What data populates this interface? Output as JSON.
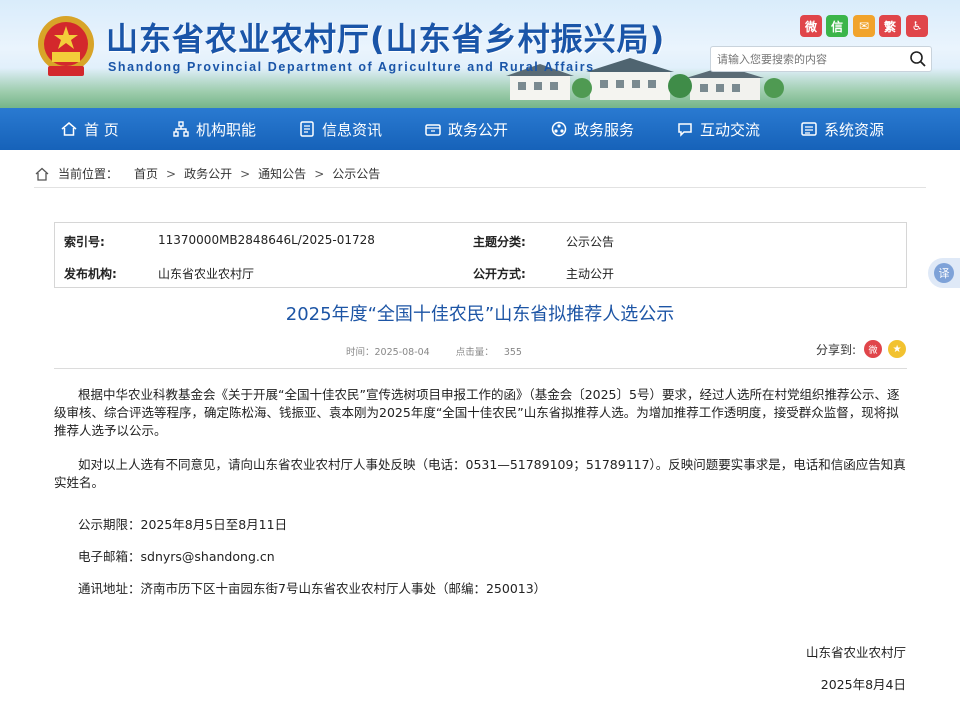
{
  "header": {
    "title": "山东省农业农村厅(山东省乡村振兴局)",
    "subtitle": "Shandong Provincial Department of Agriculture and Rural Affairs",
    "social": [
      {
        "name": "weibo-icon",
        "color": "#e0454a",
        "glyph": "微"
      },
      {
        "name": "wechat-icon",
        "color": "#3bb54a",
        "glyph": "信"
      },
      {
        "name": "mail-icon",
        "color": "#f1a32c",
        "glyph": "✉"
      },
      {
        "name": "traditional-chinese-button",
        "color": "#e0454a",
        "glyph": "繁"
      },
      {
        "name": "accessibility-icon",
        "color": "#e0454a",
        "glyph": "♿"
      }
    ],
    "search_placeholder": "请输入您要搜索的内容"
  },
  "nav": [
    {
      "label": "首 页",
      "icon": "home-icon"
    },
    {
      "label": "机构职能",
      "icon": "org-chart-icon"
    },
    {
      "label": "信息资讯",
      "icon": "document-icon"
    },
    {
      "label": "政务公开",
      "icon": "open-box-icon"
    },
    {
      "label": "政务服务",
      "icon": "service-icon"
    },
    {
      "label": "互动交流",
      "icon": "chat-icon"
    },
    {
      "label": "系统资源",
      "icon": "system-icon"
    }
  ],
  "breadcrumb": {
    "label": "当前位置：",
    "items": [
      "首页",
      "政务公开",
      "通知公告",
      "公示公告"
    ]
  },
  "info": {
    "index_label": "索引号:",
    "index_value": "11370000MB2848646L/2025-01728",
    "topic_label": "主题分类:",
    "topic_value": "公示公告",
    "publisher_label": "发布机构:",
    "publisher_value": "山东省农业农村厅",
    "method_label": "公开方式:",
    "method_value": "主动公开"
  },
  "article": {
    "title": "2025年度“全国十佳农民”山东省拟推荐人选公示",
    "time_label": "时间：",
    "time_value": "2025-08-04",
    "views_label": "点击量：",
    "views_value": "355",
    "share_label": "分享到:",
    "paragraph1": "根据中华农业科教基金会《关于开展“全国十佳农民”宣传选树项目申报工作的函》（基金会〔2025〕5号）要求，经过人选所在村党组织推荐公示、逐级审核、综合评选等程序，确定陈松海、钱振亚、袁本刚为2025年度“全国十佳农民”山东省拟推荐人选。为增加推荐工作透明度，接受群众监督，现将拟推荐人选予以公示。",
    "paragraph2": "如对以上人选有不同意见，请向山东省农业农村厅人事处反映（电话：0531—51789109；51789117）。反映问题要实事求是，电话和信函应告知真实姓名。",
    "period": "公示期限：2025年8月5日至8月11日",
    "email": "电子邮箱：sdnyrs@shandong.cn",
    "address": "通讯地址：济南市历下区十亩园东街7号山东省农业农村厅人事处（邮编：250013）",
    "sign_org": "山东省农业农村厅",
    "sign_date": "2025年8月4日"
  },
  "translate_label": "译",
  "colors": {
    "brand_blue": "#1a55a8",
    "nav_blue": "#1f6cc4",
    "title_blue": "#1d55a5"
  }
}
